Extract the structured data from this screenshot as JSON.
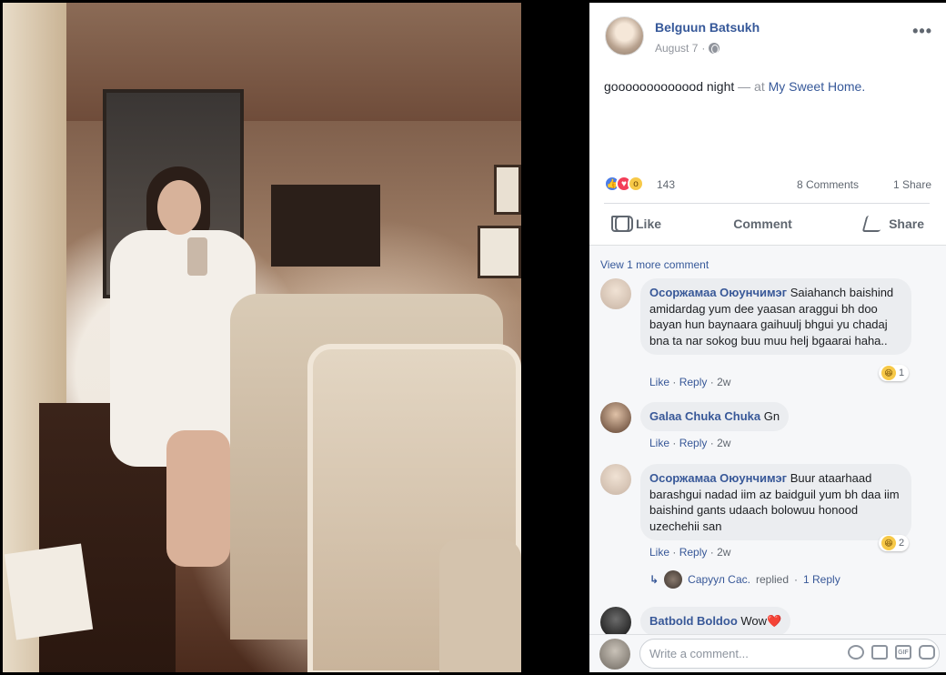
{
  "post": {
    "author": "Belguun Batsukh",
    "date": "August 7",
    "date_sep": "·",
    "status_text": "gooooooooooood night",
    "status_connector": "— at",
    "place": "My Sweet Home",
    "place_suffix": "."
  },
  "stats": {
    "reactions_count": "143",
    "comments_label": "8 Comments",
    "shares_label": "1 Share",
    "reaction_types": [
      "like-icon",
      "love-icon",
      "wow-icon"
    ]
  },
  "actions": {
    "like_label": "Like",
    "comment_label": "Comment",
    "share_label": "Share"
  },
  "comments_section": {
    "view_more_label": "View 1 more comment",
    "comments": [
      {
        "name": "Осоржамаа Оюунчимэг",
        "text": "Saiahanch baishind amidardag yum dee yaasan araggui bh doo bayan hun baynaara gaihuulj bhgui yu chadaj bna ta nar sokog buu muu helj bgaarai haha..",
        "like": "Like",
        "reply": "Reply",
        "time": "2w",
        "reaction_count": "1"
      },
      {
        "name": "Galaa Chuka Chuka",
        "text": "Gn",
        "like": "Like",
        "reply": "Reply",
        "time": "2w"
      },
      {
        "name": "Осоржамаа Оюунчимэг",
        "text": "Buur ataarhaad barashgui nadad iim az baidguil yum bh daa iim baishind gants udaach bolowuu honood uzechehii san",
        "like": "Like",
        "reply": "Reply",
        "time": "2w",
        "reaction_count": "2",
        "reply_summary": {
          "name": "Саруул Сас.",
          "verb": "replied",
          "sep": "·",
          "link": "1 Reply"
        }
      },
      {
        "name": "Batbold Boldoo",
        "text": "Wow",
        "emoji": "❤️"
      }
    ],
    "sep": "·"
  },
  "composer": {
    "placeholder": "Write a comment...",
    "icons": [
      "smiley-icon",
      "camera-icon",
      "gif-icon",
      "sticker-icon"
    ]
  },
  "colors": {
    "link": "#365899",
    "muted": "#90949c",
    "like_blue": "#4a7ce8",
    "love_red": "#f33e58",
    "haha_yellow": "#f7c948"
  }
}
